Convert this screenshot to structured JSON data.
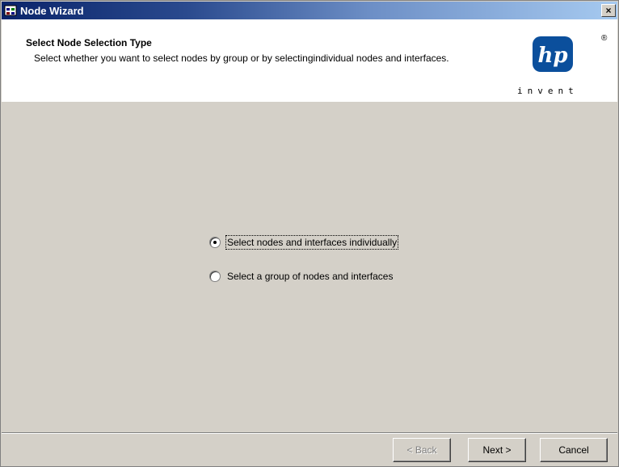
{
  "window": {
    "title": "Node Wizard",
    "close_glyph": "×"
  },
  "header": {
    "title": "Select Node Selection Type",
    "description": "Select whether you want to select nodes by group or by selectingindividual nodes and interfaces.",
    "logo_text": "hp",
    "logo_tagline": "invent",
    "logo_registered": "®"
  },
  "options": [
    {
      "label": "Select nodes and interfaces individually",
      "checked": true
    },
    {
      "label": "Select a group of nodes and interfaces",
      "checked": false
    }
  ],
  "buttons": {
    "back": "< Back",
    "next": "Next >",
    "cancel": "Cancel"
  },
  "colors": {
    "titlebar_start": "#0a246a",
    "titlebar_end": "#a6caf0",
    "logo_blue": "#0b4f9c",
    "dialog_gray": "#d4d0c8"
  }
}
